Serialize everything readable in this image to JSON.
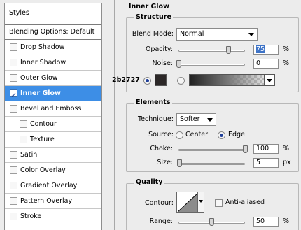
{
  "left_panel": {
    "header": "Styles",
    "blending_options": "Blending Options: Default",
    "effects": [
      {
        "label": "Drop Shadow",
        "checked": false,
        "indented": false,
        "selected": false
      },
      {
        "label": "Inner Shadow",
        "checked": false,
        "indented": false,
        "selected": false
      },
      {
        "label": "Outer Glow",
        "checked": false,
        "indented": false,
        "selected": false
      },
      {
        "label": "Inner Glow",
        "checked": true,
        "indented": false,
        "selected": true
      },
      {
        "label": "Bevel and Emboss",
        "checked": false,
        "indented": false,
        "selected": false
      },
      {
        "label": "Contour",
        "checked": false,
        "indented": true,
        "selected": false
      },
      {
        "label": "Texture",
        "checked": false,
        "indented": true,
        "selected": false
      },
      {
        "label": "Satin",
        "checked": false,
        "indented": false,
        "selected": false
      },
      {
        "label": "Color Overlay",
        "checked": false,
        "indented": false,
        "selected": false
      },
      {
        "label": "Gradient Overlay",
        "checked": false,
        "indented": false,
        "selected": false
      },
      {
        "label": "Pattern Overlay",
        "checked": false,
        "indented": false,
        "selected": false
      },
      {
        "label": "Stroke",
        "checked": false,
        "indented": false,
        "selected": false
      }
    ]
  },
  "inner_glow": {
    "title": "Inner Glow",
    "structure": {
      "title": "Structure",
      "blend_mode_label": "Blend Mode:",
      "blend_mode_value": "Normal",
      "opacity_label": "Opacity:",
      "opacity_value": "75",
      "opacity_unit": "%",
      "opacity_level": 0.75,
      "noise_label": "Noise:",
      "noise_value": "0",
      "noise_unit": "%",
      "noise_level": 0,
      "color_hex": "2b2727",
      "swatch_color": "#2b2727"
    },
    "elements": {
      "title": "Elements",
      "technique_label": "Technique:",
      "technique_value": "Softer",
      "source_label": "Source:",
      "center_label": "Center",
      "edge_label": "Edge",
      "choke_label": "Choke:",
      "choke_value": "100",
      "choke_unit": "%",
      "choke_level": 1.0,
      "size_label": "Size:",
      "size_value": "5",
      "size_unit": "px",
      "size_level": 0.02
    },
    "quality": {
      "title": "Quality",
      "contour_label": "Contour:",
      "anti_aliased_label": "Anti-aliased",
      "range_label": "Range:",
      "range_value": "50",
      "range_unit": "%",
      "range_level": 0.5
    }
  },
  "colors": {
    "selection_blue": "#3d8ee6",
    "text_highlight": "#3d73c7",
    "panel_bg": "#ececec"
  }
}
